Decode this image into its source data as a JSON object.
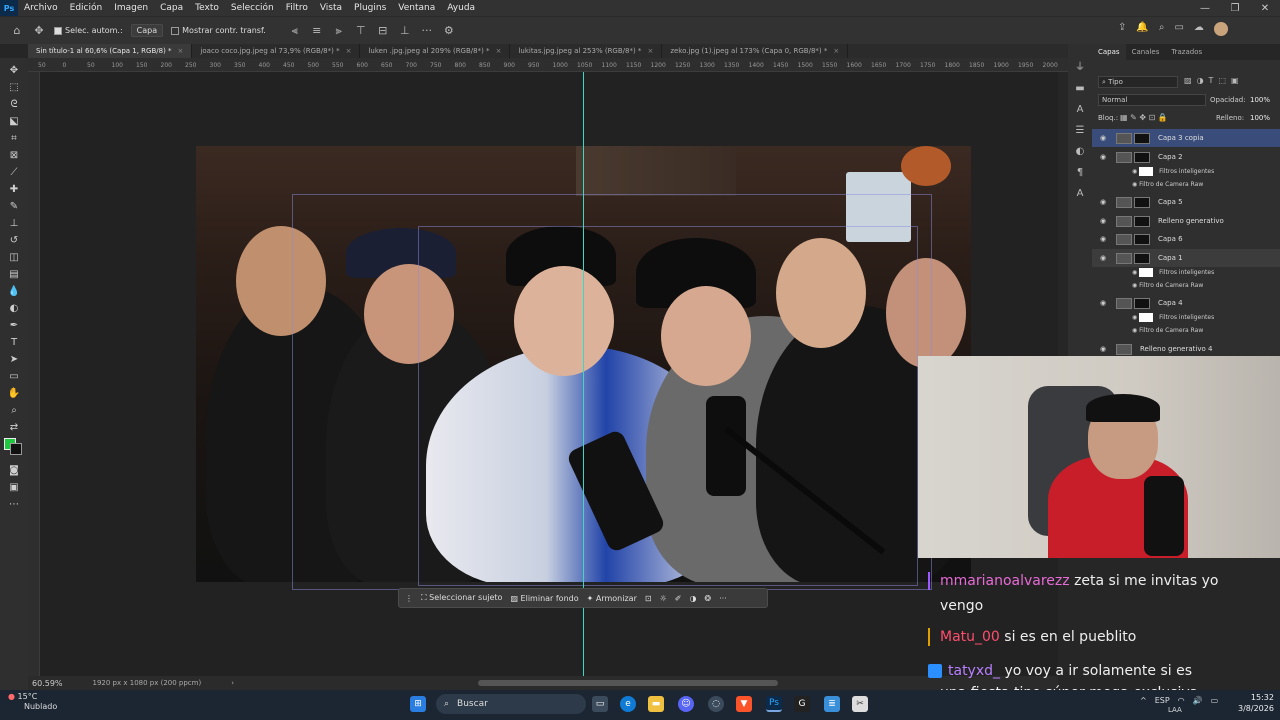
{
  "menu": {
    "app_icon": "Ps",
    "items": [
      "Archivo",
      "Edición",
      "Imagen",
      "Capa",
      "Texto",
      "Selección",
      "Filtro",
      "Vista",
      "Plugins",
      "Ventana",
      "Ayuda"
    ]
  },
  "options": {
    "auto_select_label": "Selec. autom.:",
    "auto_select_value": "Capa",
    "show_transform_label": "Mostrar contr. transf."
  },
  "tabs": [
    {
      "label": "Sin título-1 al 60,6% (Capa 1, RGB/8) *",
      "active": true
    },
    {
      "label": "joaco coco.jpg.jpeg al 73,9% (RGB/8*) *",
      "active": false
    },
    {
      "label": "luken .jpg.jpeg al 209% (RGB/8*) *",
      "active": false
    },
    {
      "label": "lukitas.jpg.jpeg al 253% (RGB/8*) *",
      "active": false
    },
    {
      "label": "zeko.jpg (1).jpeg al 173% (Capa 0, RGB/8*) *",
      "active": false
    }
  ],
  "ruler_ticks": [
    "50",
    "0",
    "50",
    "100",
    "150",
    "200",
    "250",
    "300",
    "350",
    "400",
    "450",
    "500",
    "550",
    "600",
    "650",
    "700",
    "750",
    "800",
    "850",
    "900",
    "950",
    "1000",
    "1050",
    "1100",
    "1150",
    "1200",
    "1250",
    "1300",
    "1350",
    "1400",
    "1450",
    "1500",
    "1550",
    "1600",
    "1650",
    "1700",
    "1750",
    "1800",
    "1850",
    "1900",
    "1950",
    "2000"
  ],
  "context_bar": {
    "select_subject": "Seleccionar sujeto",
    "remove_bg": "Eliminar fondo",
    "harmonize": "Armonizar"
  },
  "status": {
    "zoom": "60.59%",
    "doc_size": "1920 px x 1080 px (200 ppcm)"
  },
  "layers_panel": {
    "tabs": [
      "Capas",
      "Canales",
      "Trazados"
    ],
    "filter_label": "Tipo",
    "blend_mode": "Normal",
    "opacity_label": "Opacidad:",
    "opacity_value": "100%",
    "lock_label": "Bloq.:",
    "fill_label": "Relleno:",
    "fill_value": "100%",
    "layers": [
      {
        "name": "Capa 3 copia",
        "selected": true
      },
      {
        "name": "Capa 2",
        "selected": false
      },
      {
        "name": "Capa 5",
        "selected": false
      },
      {
        "name": "Relleno generativo",
        "selected": false
      },
      {
        "name": "Capa 6",
        "selected": false
      },
      {
        "name": "Capa 1",
        "selected": false
      },
      {
        "name": "Capa 4",
        "selected": false
      },
      {
        "name": "Relleno generativo 4",
        "selected": false
      }
    ],
    "smart_filters": "Filtros inteligentes",
    "camera_raw": "Filtro de Camera Raw"
  },
  "chat": [
    {
      "user": "mmarianoalvarezz",
      "text": "zeta si me invitas yo",
      "cont": "vengo",
      "color": "#e66bd6",
      "bar": "#9b59ff"
    },
    {
      "user": "Matu_00",
      "text": "si es en el pueblito",
      "cont": "",
      "color": "#ff4d6d",
      "bar": "#e0a000"
    },
    {
      "user": "tatyxd_",
      "text": "yo voy a ir solamente si es",
      "cont": "una fiesta tipo súper mega exclusiva",
      "color": "#b980ff",
      "bar": "#2b8fff"
    }
  ],
  "taskbar": {
    "weather_temp": "15°C",
    "weather_desc": "Nublado",
    "search": "Buscar",
    "lang": "ESP",
    "lang_sub": "LAA",
    "time": "15:32",
    "date": "3/8/2026"
  },
  "colors": {
    "foreground": "#20c840",
    "background": "#111111",
    "guide": "#3fd6c4",
    "accent": "#31a8ff"
  }
}
